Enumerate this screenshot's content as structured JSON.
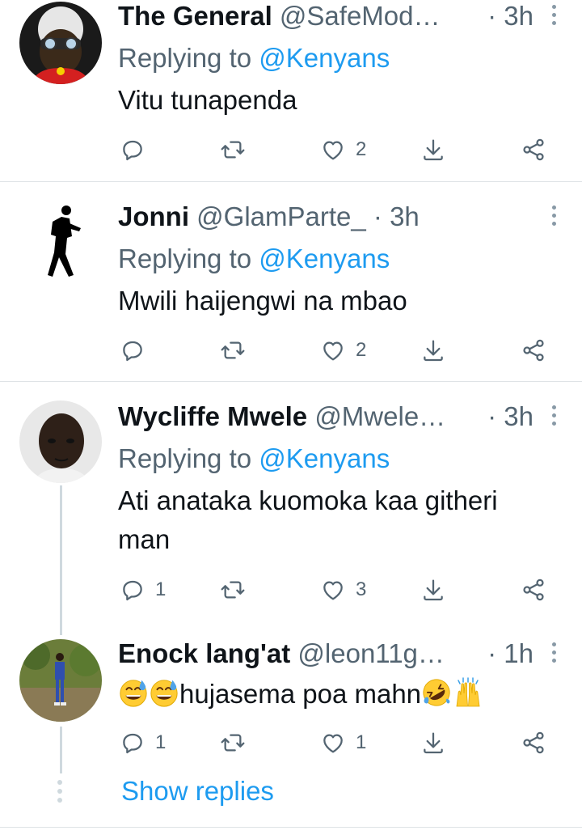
{
  "tweets": [
    {
      "name": "The General",
      "handle": "@SafeMod…",
      "time": "· 3h",
      "replying_label": "Replying to",
      "replying_to": "@Kenyans",
      "text": "Vitu tunapenda",
      "replies": "",
      "likes": "2"
    },
    {
      "name": "Jonni",
      "handle": "@GlamParte_",
      "time": "· 3h",
      "replying_label": "Replying to",
      "replying_to": "@Kenyans",
      "text": "Mwili haijengwi na mbao",
      "replies": "",
      "likes": "2"
    },
    {
      "name": "Wycliffe Mwele",
      "handle": "@Mwele…",
      "time": "· 3h",
      "replying_label": "Replying to",
      "replying_to": "@Kenyans",
      "text_line1": "Ati anataka kuomoka kaa githeri",
      "text_line2": "man",
      "replies": "1",
      "likes": "3"
    },
    {
      "name": "Enock lang'at",
      "handle": "@leon11g…",
      "time": "· 1h",
      "text": "hujasema poa mahn",
      "replies": "1",
      "likes": "1"
    }
  ],
  "show_replies": "Show replies",
  "colors": {
    "accent": "#1d9bf0",
    "secondary_text": "#536471",
    "divider": "#dfe3e6"
  },
  "icons": [
    "more-icon",
    "reply-icon",
    "retweet-icon",
    "like-icon",
    "download-icon",
    "share-icon"
  ]
}
